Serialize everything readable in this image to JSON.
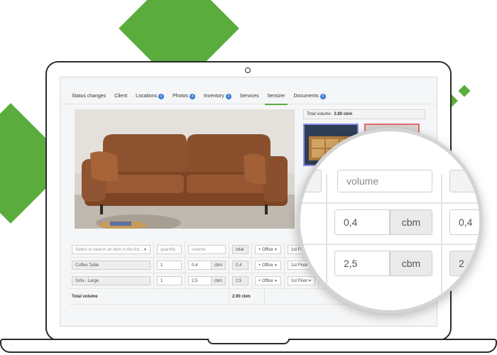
{
  "tabs": [
    {
      "label": "Status changes",
      "badge": null
    },
    {
      "label": "Client",
      "badge": null
    },
    {
      "label": "Locations",
      "badge": "2"
    },
    {
      "label": "Photos",
      "badge": "4"
    },
    {
      "label": "Inventory",
      "badge": "3"
    },
    {
      "label": "Services",
      "badge": null
    },
    {
      "label": "Itemizer",
      "badge": null,
      "active": true
    },
    {
      "label": "Documents",
      "badge": "0"
    }
  ],
  "side_panel": {
    "total_label": "Total volume:",
    "total_value": "2.80 cbm"
  },
  "table": {
    "header": {
      "search_placeholder": "Select or search an item in the list...",
      "quantity_placeholder": "quantity",
      "volume_placeholder": "volume",
      "total_label": "total",
      "room_select": "+ Office",
      "floor_select": "1st Floor"
    },
    "rows": [
      {
        "item": "Coffee Table",
        "quantity": "1",
        "volume": "0,4",
        "unit": "cbm",
        "total": "0,4",
        "room": "+ Office",
        "floor": "1st Floor"
      },
      {
        "item": "Sofa - Large",
        "quantity": "1",
        "volume": "2,5",
        "unit": "cbm",
        "total": "2,5",
        "room": "+ Office",
        "floor": "1st Floor"
      }
    ],
    "footer": {
      "label": "Total volume",
      "value": "2.90 cbm"
    }
  },
  "magnifier": {
    "volume_placeholder": "volume",
    "row1_value": "0,4",
    "row1_unit": "cbm",
    "row2_value": "2,5",
    "row2_unit": "cbm",
    "row1_partial": "0,4",
    "row2_partial": "2"
  },
  "colors": {
    "accent_green": "#5aad3c",
    "badge_blue": "#3a7bd5",
    "sofa_leather": "#8b4f2a"
  }
}
